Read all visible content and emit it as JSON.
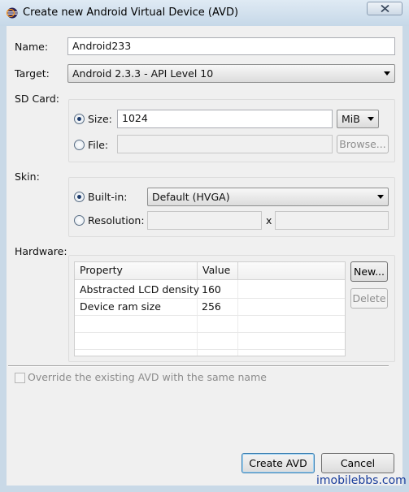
{
  "window": {
    "title": "Create new Android Virtual Device (AVD)",
    "icon": "eclipse-icon"
  },
  "name": {
    "label": "Name:",
    "value": "Android233"
  },
  "target": {
    "label": "Target:",
    "value": "Android 2.3.3 - API Level 10"
  },
  "sdcard": {
    "label": "SD Card:",
    "size_label": "Size:",
    "size_value": "1024",
    "unit": "MiB",
    "file_label": "File:",
    "file_value": "",
    "browse_label": "Browse...",
    "selected": "size"
  },
  "skin": {
    "label": "Skin:",
    "builtin_label": "Built-in:",
    "builtin_value": "Default (HVGA)",
    "resolution_label": "Resolution:",
    "resolution_x": "x",
    "selected": "builtin"
  },
  "hardware": {
    "label": "Hardware:",
    "columns": [
      "Property",
      "Value"
    ],
    "rows": [
      {
        "property": "Abstracted LCD density",
        "value": "160"
      },
      {
        "property": "Device ram size",
        "value": "256"
      }
    ],
    "new_label": "New...",
    "delete_label": "Delete"
  },
  "override_label": "Override the existing AVD with the same name",
  "create_label": "Create AVD",
  "cancel_label": "Cancel",
  "watermark": "imobilebbs.com",
  "colors": {
    "accent": "#3c7fb1",
    "watermark": "#1a3e9c"
  }
}
